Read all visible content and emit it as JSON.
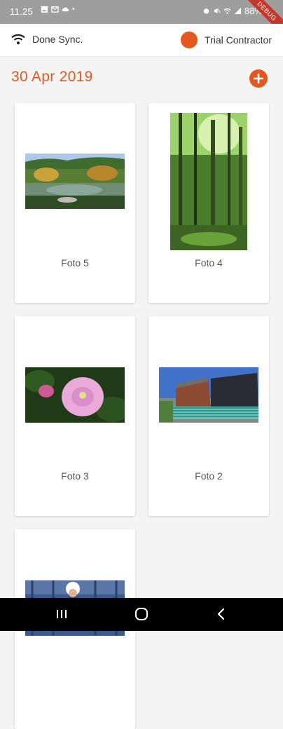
{
  "status_bar": {
    "time": "11.25",
    "battery": "88%"
  },
  "debug_ribbon": "DEBUG",
  "sync": {
    "icon": "wifi-icon",
    "label": "Done Sync."
  },
  "user": {
    "name": "Trial Contractor",
    "avatar_color": "#e4571e"
  },
  "date_header": {
    "title": "30 Apr 2019",
    "add_icon": "plus-circle-icon",
    "accent": "#e4571e"
  },
  "photos": [
    {
      "caption": "Foto 5",
      "image": "japanese-garden-pond"
    },
    {
      "caption": "Foto 4",
      "image": "bamboo-forest"
    },
    {
      "caption": "Foto 3",
      "image": "pink-hibiscus-flower"
    },
    {
      "caption": "Foto 2",
      "image": "brick-building-with-railing"
    },
    {
      "caption": "",
      "image": "person-in-hardhat"
    }
  ],
  "nav_bar": {
    "recent_icon": "recent-apps-icon",
    "home_icon": "home-icon",
    "back_icon": "back-icon"
  }
}
